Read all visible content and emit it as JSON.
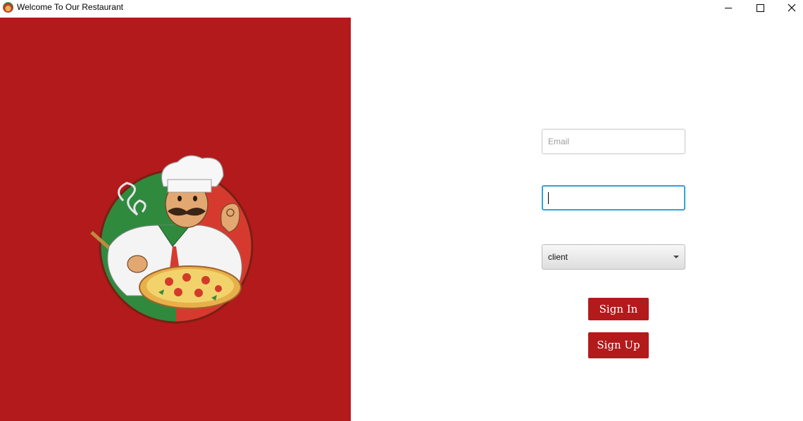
{
  "window": {
    "title": "Welcome To Our Restaurant",
    "controls": [
      "minimize-icon",
      "maximize-icon",
      "close-icon"
    ]
  },
  "left_panel": {
    "background": "#b21a1c",
    "logo": "chef-pizza-logo"
  },
  "form": {
    "email": {
      "value": "",
      "placeholder": "Email"
    },
    "password": {
      "value": ""
    },
    "role": {
      "selected": "client"
    },
    "sign_in_label": "Sign In",
    "sign_up_label": "Sign Up"
  },
  "colors": {
    "accent": "#b21a1c",
    "focus": "#2ea3dc"
  }
}
